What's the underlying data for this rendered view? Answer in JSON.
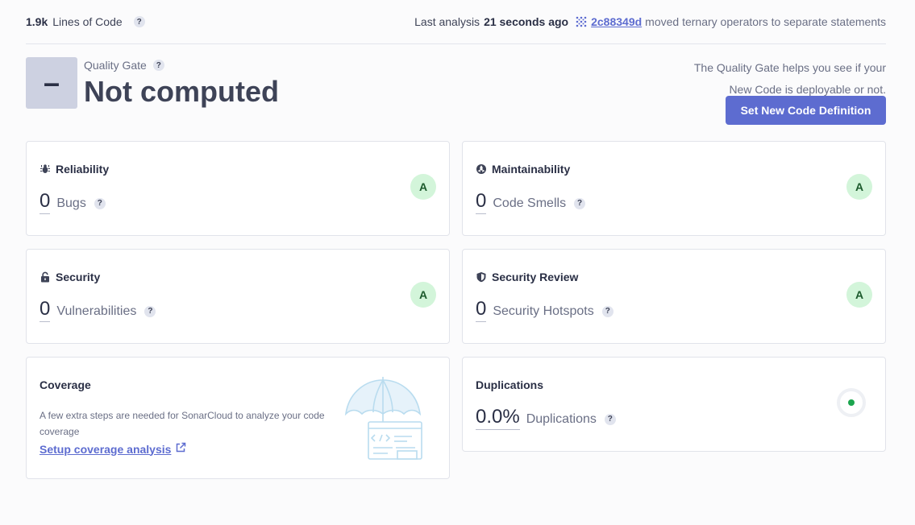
{
  "topbar": {
    "lines_of_code_value": "1.9k",
    "lines_of_code_label": "Lines of Code",
    "help_glyph": "?",
    "analysis_prefix": "Last analysis",
    "analysis_time": "21 seconds ago",
    "commit_hash": "2c88349d",
    "commit_message": "moved ternary operators to separate statements"
  },
  "quality_gate": {
    "label": "Quality Gate",
    "badge_symbol": "–",
    "status": "Not computed",
    "help_text_line1": "The Quality Gate helps you see if your",
    "help_text_line2": "New Code is deployable or not.",
    "button_label": "Set New Code Definition"
  },
  "cards": {
    "reliability": {
      "title": "Reliability",
      "value": "0",
      "label": "Bugs",
      "rating": "A"
    },
    "maintainability": {
      "title": "Maintainability",
      "value": "0",
      "label": "Code Smells",
      "rating": "A"
    },
    "security": {
      "title": "Security",
      "value": "0",
      "label": "Vulnerabilities",
      "rating": "A"
    },
    "security_review": {
      "title": "Security Review",
      "value": "0",
      "label": "Security Hotspots",
      "rating": "A"
    },
    "coverage": {
      "title": "Coverage",
      "text": "A few extra steps are needed for SonarCloud to analyze your code coverage",
      "link": "Setup coverage analysis"
    },
    "duplications": {
      "title": "Duplications",
      "value": "0.0%",
      "label": "Duplications"
    }
  },
  "colors": {
    "accent": "#5d6cd0",
    "rating_bg": "#d3f5da",
    "rating_text": "#1c5a2c",
    "gate_badge": "#cdd1e1",
    "dup_dot": "#1ba54e"
  },
  "icons": {
    "reliability": "bug-icon",
    "maintainability": "smell-icon",
    "security": "lock-icon",
    "security_review": "shield-icon",
    "commit": "commit-grid-icon",
    "external_link": "external-link-icon",
    "coverage_illustration": "umbrella-code-illustration"
  }
}
